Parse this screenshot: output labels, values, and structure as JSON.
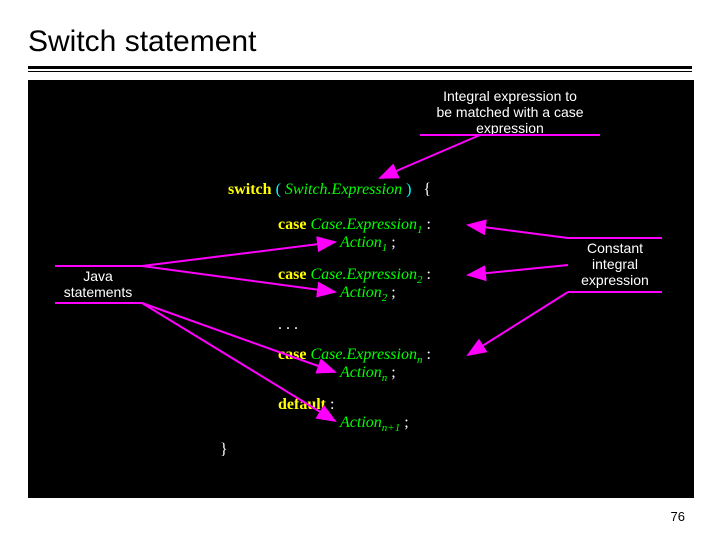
{
  "title": "Switch statement",
  "annotations": {
    "top": "Integral expression to\nbe matched with a case\nexpression",
    "left": "Java\nstatements",
    "right": "Constant\nintegral\nexpression"
  },
  "code": {
    "switch_kw": "switch",
    "switch_expr": "Switch.Expression",
    "open_paren": "(",
    "close_paren": ")",
    "open_brace": "{",
    "case_kw": "case",
    "case1_expr": "Case.Expression",
    "case1_sub": "1",
    "action1": "Action",
    "action1_sub": "1",
    "case2_expr": "Case.Expression",
    "case2_sub": "2",
    "action2": "Action",
    "action2_sub": "2",
    "ellipsis": ". . .",
    "casen_expr": "Case.Expression",
    "casen_sub": "n",
    "actionn": "Action",
    "actionn_sub": "n",
    "default_kw": "default",
    "action_np1": "Action",
    "action_np1_sub": "n+1",
    "semicolon": ";",
    "colon": ":",
    "close_brace": "}"
  },
  "page_number": "76",
  "colors": {
    "arrow_magenta": "#ff00ff"
  }
}
